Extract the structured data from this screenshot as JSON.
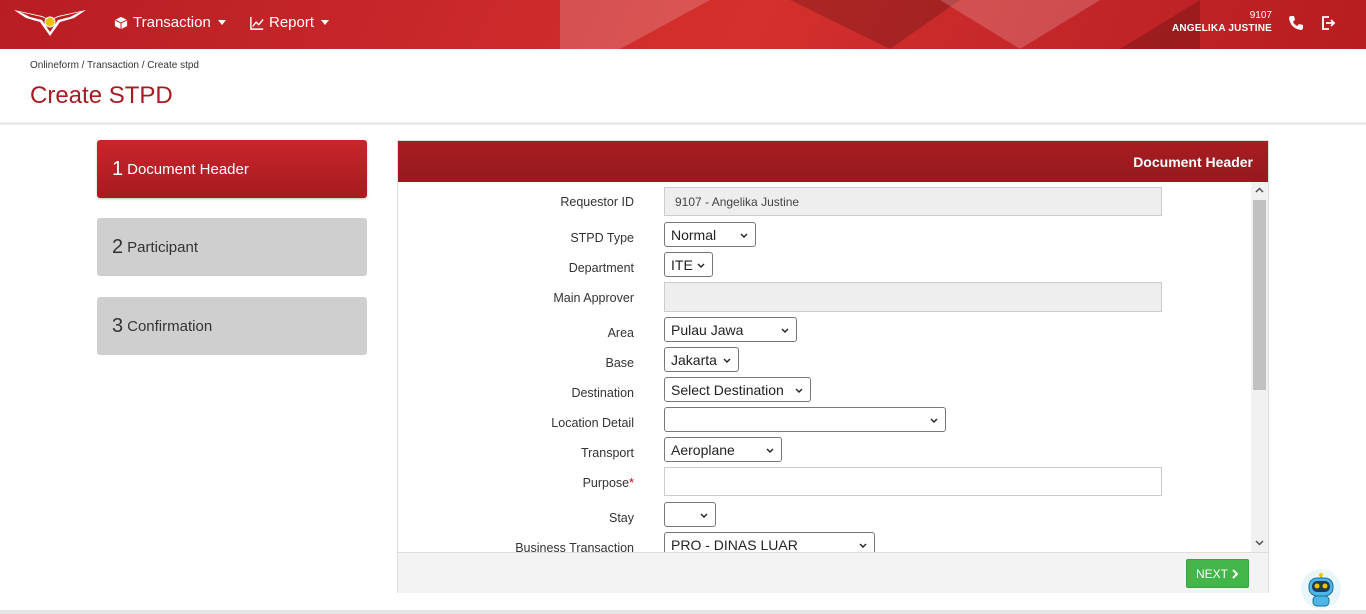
{
  "nav": {
    "transaction": "Transaction",
    "report": "Report"
  },
  "user": {
    "id": "9107",
    "name": "ANGELIKA JUSTINE"
  },
  "breadcrumb": "Onlineform / Transaction / Create stpd",
  "page_title": "Create STPD",
  "steps": [
    {
      "num": "1",
      "label": "Document Header"
    },
    {
      "num": "2",
      "label": "Participant"
    },
    {
      "num": "3",
      "label": "Confirmation"
    }
  ],
  "panel_title": "Document Header",
  "form": {
    "requestor_id": {
      "label": "Requestor ID",
      "value": "9107 - Angelika Justine"
    },
    "stpd_type": {
      "label": "STPD Type",
      "value": "Normal"
    },
    "department": {
      "label": "Department",
      "value": "ITE"
    },
    "main_approver": {
      "label": "Main Approver",
      "value": ""
    },
    "area": {
      "label": "Area",
      "value": "Pulau Jawa"
    },
    "base": {
      "label": "Base",
      "value": "Jakarta"
    },
    "destination": {
      "label": "Destination",
      "value": "Select Destination"
    },
    "location_detail": {
      "label": "Location Detail",
      "value": ""
    },
    "transport": {
      "label": "Transport",
      "value": "Aeroplane"
    },
    "purpose": {
      "label": "Purpose",
      "required_mark": "*",
      "value": ""
    },
    "stay": {
      "label": "Stay",
      "value": ""
    },
    "business_transaction": {
      "label": "Business Transaction",
      "value": "PRO - DINAS LUAR"
    }
  },
  "next_label": "NEXT",
  "colors": {
    "brand_red": "#a51d23",
    "next_green": "#44b549"
  }
}
